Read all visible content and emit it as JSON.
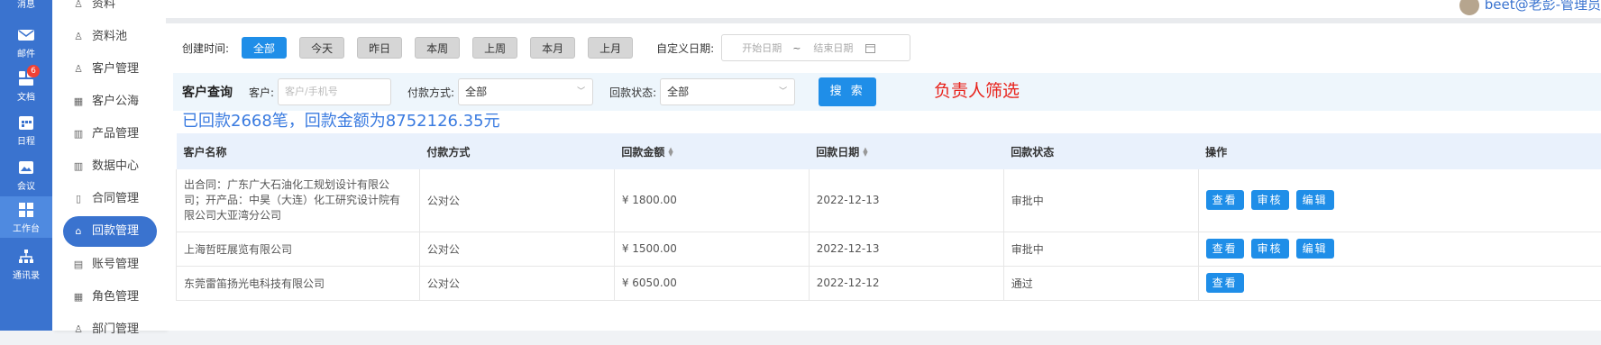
{
  "rail": {
    "items": [
      {
        "label": "消息",
        "icon": "message-icon"
      },
      {
        "label": "邮件",
        "icon": "mail-icon"
      },
      {
        "label": "文档",
        "icon": "document-icon",
        "badge": "6"
      },
      {
        "label": "日程",
        "icon": "calendar-icon"
      },
      {
        "label": "会议",
        "icon": "meeting-icon"
      },
      {
        "label": "工作台",
        "icon": "workbench-icon"
      },
      {
        "label": "通讯录",
        "icon": "contacts-icon"
      }
    ]
  },
  "menu": {
    "items": [
      {
        "label": "资料",
        "icon": "user-icon"
      },
      {
        "label": "资料池",
        "icon": "user-icon"
      },
      {
        "label": "客户管理",
        "icon": "user-icon"
      },
      {
        "label": "客户公海",
        "icon": "building-icon"
      },
      {
        "label": "产品管理",
        "icon": "bar-chart-icon"
      },
      {
        "label": "数据中心",
        "icon": "bar-chart-icon"
      },
      {
        "label": "合同管理",
        "icon": "file-icon"
      },
      {
        "label": "回款管理",
        "icon": "bank-icon"
      },
      {
        "label": "账号管理",
        "icon": "id-card-icon"
      },
      {
        "label": "角色管理",
        "icon": "grid-icon"
      },
      {
        "label": "部门管理",
        "icon": "user-icon"
      }
    ]
  },
  "user": {
    "label": "beet@老彭-管理员"
  },
  "date_filter": {
    "label": "创建时间:",
    "options": [
      "全部",
      "今天",
      "昨日",
      "本周",
      "上周",
      "本月",
      "上月"
    ],
    "custom_label": "自定义日期:",
    "start_placeholder": "开始日期",
    "separator": "~",
    "end_placeholder": "结束日期"
  },
  "search": {
    "title": "客户查询",
    "customer_label": "客户:",
    "customer_placeholder": "客户/手机号",
    "pay_label": "付款方式:",
    "pay_value": "全部",
    "status_label": "回款状态:",
    "status_value": "全部",
    "button": "搜 索"
  },
  "annotation": "负责人筛选",
  "summary": "已回款2668笔，回款金额为8752126.35元",
  "table": {
    "headers": [
      "客户名称",
      "付款方式",
      "回款金额",
      "回款日期",
      "回款状态",
      "操作"
    ],
    "rows": [
      {
        "name": "出合同：广东广大石油化工规划设计有限公司；开产品：中昊（大连）化工研究设计院有限公司大亚湾分公司",
        "pay": "公对公",
        "amount": "¥ 1800.00",
        "date": "2022-12-13",
        "status": "审批中",
        "actions": [
          "查看",
          "审核",
          "编辑"
        ]
      },
      {
        "name": "上海哲旺展览有限公司",
        "pay": "公对公",
        "amount": "¥ 1500.00",
        "date": "2022-12-13",
        "status": "审批中",
        "actions": [
          "查看",
          "审核",
          "编辑"
        ]
      },
      {
        "name": "东莞雷笛扬光电科技有限公司",
        "pay": "公对公",
        "amount": "¥ 6050.00",
        "date": "2022-12-12",
        "status": "通过",
        "actions": [
          "查看"
        ]
      }
    ]
  },
  "colors": {
    "primary": "#1f8ee8",
    "rail": "#3a73cf",
    "pending": "#f39c12",
    "annotation": "#e8221b"
  }
}
